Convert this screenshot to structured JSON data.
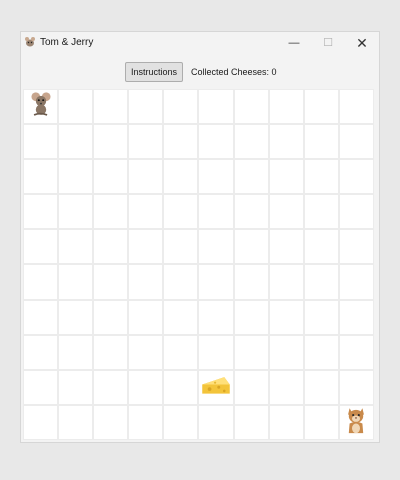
{
  "window": {
    "title": "Tom & Jerry",
    "app_icon": "tom-and-jerry-app-icon",
    "controls": {
      "minimize": "—",
      "maximize": "☐",
      "close": "✕"
    }
  },
  "toolbar": {
    "instructions_label": "Instructions",
    "collected_label": "Collected Cheeses: 0"
  },
  "board": {
    "rows": 10,
    "cols": 10,
    "pieces": [
      {
        "name": "jerry-mouse",
        "icon": "mouse-icon",
        "row": 0,
        "col": 0
      },
      {
        "name": "cheese",
        "icon": "cheese-icon",
        "row": 8,
        "col": 5
      },
      {
        "name": "tom-cat",
        "icon": "cat-icon",
        "row": 9,
        "col": 9
      }
    ]
  },
  "colors": {
    "window_bg": "#f3f3f3",
    "grid_line": "#ececec",
    "cheese": "#f3c43a",
    "mouse": "#8a7665",
    "cat": "#c98a4b"
  }
}
